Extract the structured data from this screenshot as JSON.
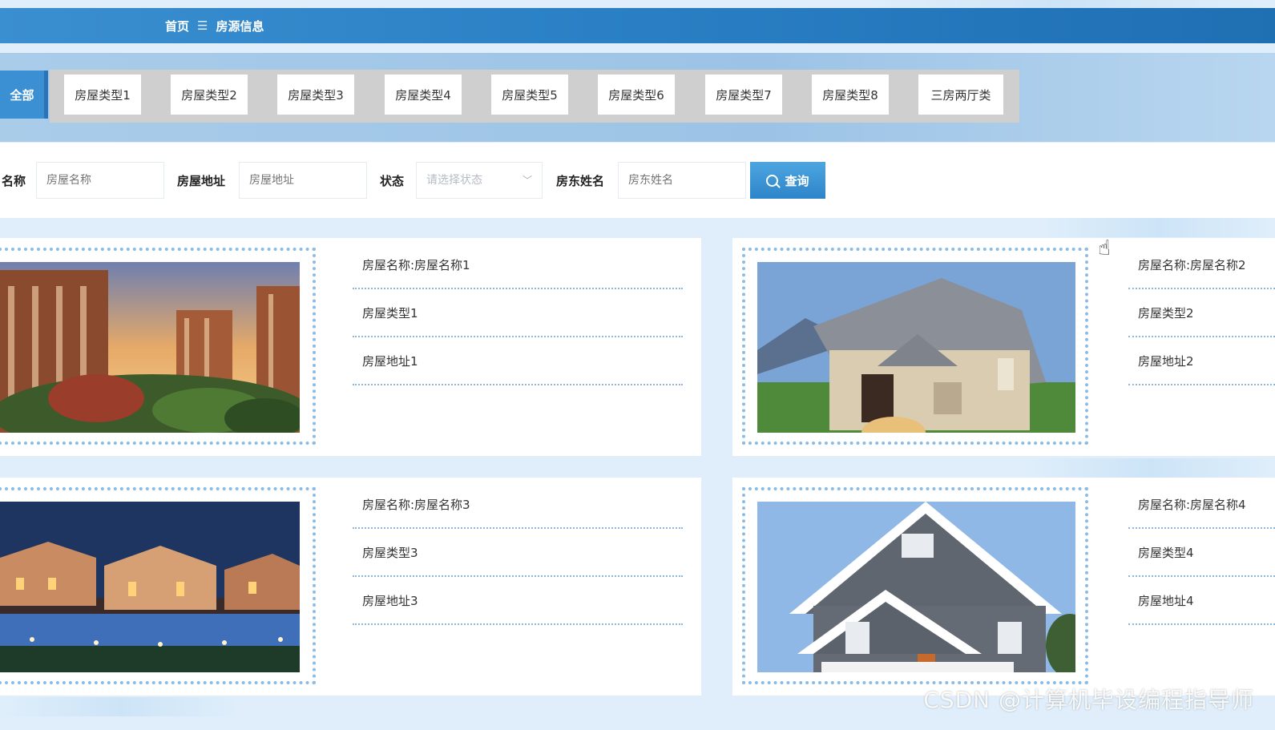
{
  "breadcrumb": {
    "home": "首页",
    "separator": "☰",
    "current": "房源信息"
  },
  "categories": {
    "all_label": "全部",
    "items": [
      "房屋类型1",
      "房屋类型2",
      "房屋类型3",
      "房屋类型4",
      "房屋类型5",
      "房屋类型6",
      "房屋类型7",
      "房屋类型8",
      "三房两厅类"
    ]
  },
  "search": {
    "name_label": "名称",
    "name_placeholder": "房屋名称",
    "address_label": "房屋地址",
    "address_placeholder": "房屋地址",
    "status_label": "状态",
    "status_placeholder": "请选择状态",
    "landlord_label": "房东姓名",
    "landlord_placeholder": "房东姓名",
    "button_label": "查询"
  },
  "listings": [
    {
      "name": "房屋名称:房屋名称1",
      "type": "房屋类型1",
      "address": "房屋地址1"
    },
    {
      "name": "房屋名称:房屋名称2",
      "type": "房屋类型2",
      "address": "房屋地址2"
    },
    {
      "name": "房屋名称:房屋名称3",
      "type": "房屋类型3",
      "address": "房屋地址3"
    },
    {
      "name": "房屋名称:房屋名称4",
      "type": "房屋类型4",
      "address": "房屋地址4"
    }
  ],
  "watermark": "CSDN @计算机毕设编程指导师",
  "colors": {
    "accent": "#2a7fc4",
    "dotted": "#8dbbe2"
  }
}
